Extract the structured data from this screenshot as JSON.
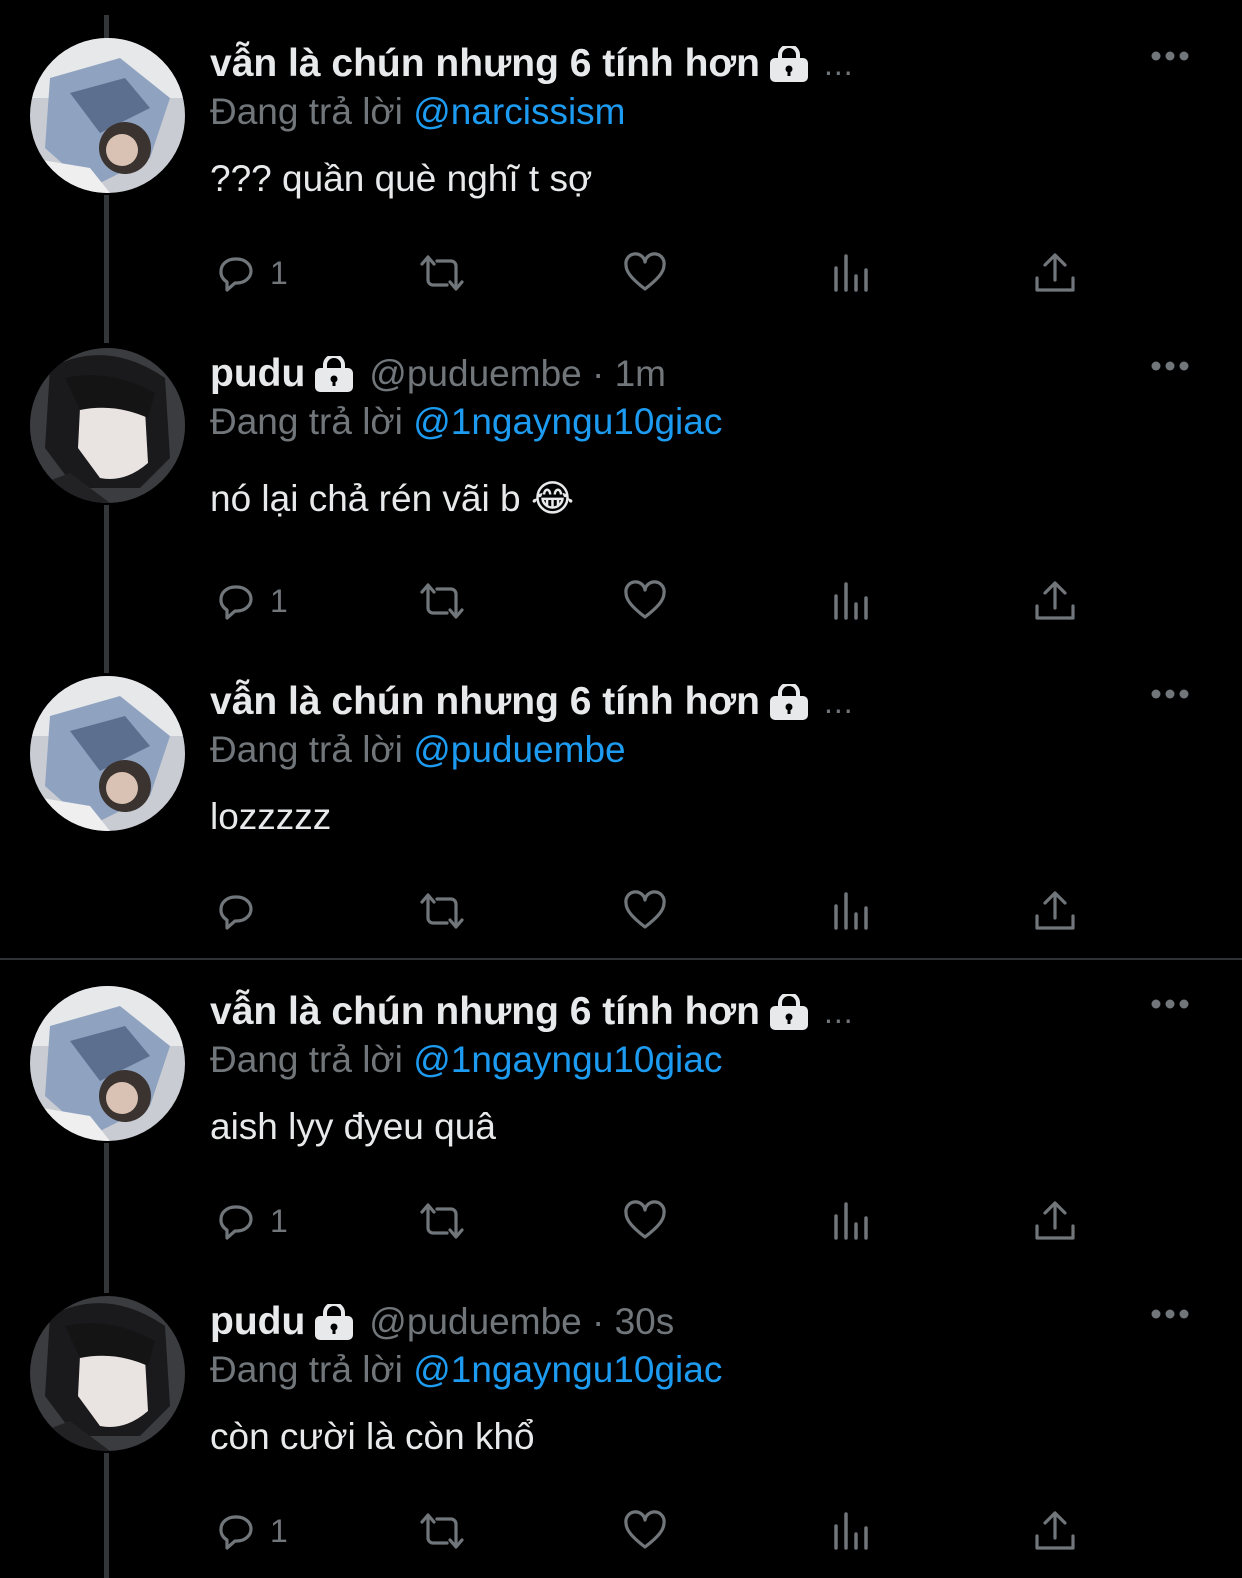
{
  "tweets": [
    {
      "name": "vẫn là chún nhưng 6 tính hơn",
      "handle_meta": "...",
      "reply_prefix": "Đang trả lời",
      "reply_to": "@narcissism",
      "text": "??? quần què nghĩ t sợ",
      "reply_count": "1",
      "avatar": "avatar-a"
    },
    {
      "name": "pudu",
      "handle_meta": "@puduembe · 1m",
      "reply_prefix": "Đang trả lời",
      "reply_to": "@1ngayngu10giac",
      "text": "nó lại chả rén vãi b 😂",
      "reply_count": "1",
      "avatar": "avatar-b"
    },
    {
      "name": "vẫn là chún nhưng 6 tính hơn",
      "handle_meta": "...",
      "reply_prefix": "Đang trả lời",
      "reply_to": "@puduembe",
      "text": "lozzzzz",
      "reply_count": "",
      "avatar": "avatar-a"
    },
    {
      "name": "vẫn là chún nhưng 6 tính hơn",
      "handle_meta": "...",
      "reply_prefix": "Đang trả lời",
      "reply_to": "@1ngayngu10giac",
      "text": "aish lyy đyeu quâ",
      "reply_count": "1",
      "avatar": "avatar-a"
    },
    {
      "name": "pudu",
      "handle_meta": "@puduembe · 30s",
      "reply_prefix": "Đang trả lời",
      "reply_to": "@1ngayngu10giac",
      "text": "còn cười là còn khổ",
      "reply_count": "1",
      "avatar": "avatar-b"
    }
  ],
  "icons": {
    "lock": "lock-icon",
    "more": "more-icon",
    "reply": "reply-icon",
    "retweet": "retweet-icon",
    "like": "like-icon",
    "views": "views-icon",
    "share": "share-icon"
  },
  "colors": {
    "background": "#000000",
    "text": "#e7e9ea",
    "muted": "#71767b",
    "mention": "#1d9bf0",
    "divider": "#2f3336"
  }
}
